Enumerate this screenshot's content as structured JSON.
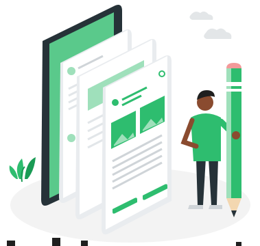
{
  "illustration": {
    "subject": "wireframe-mockup-screens",
    "character": "person-holding-giant-pencil",
    "plant": "leaf-plant",
    "clouds": 2
  },
  "colors": {
    "accent": "#2ebd6f",
    "accent_light": "#9fe0bb",
    "accent_dark": "#1a9b55",
    "phone_body": "#263238",
    "card": "#ffffff",
    "card_shadow": "#e9ecef",
    "line": "#cfd4d8",
    "skin": "#8a4b2f",
    "hair": "#1f1f1f",
    "pants": "#263238",
    "pencil_tip": "#f39a9a",
    "ground": "#f1f1f1"
  }
}
